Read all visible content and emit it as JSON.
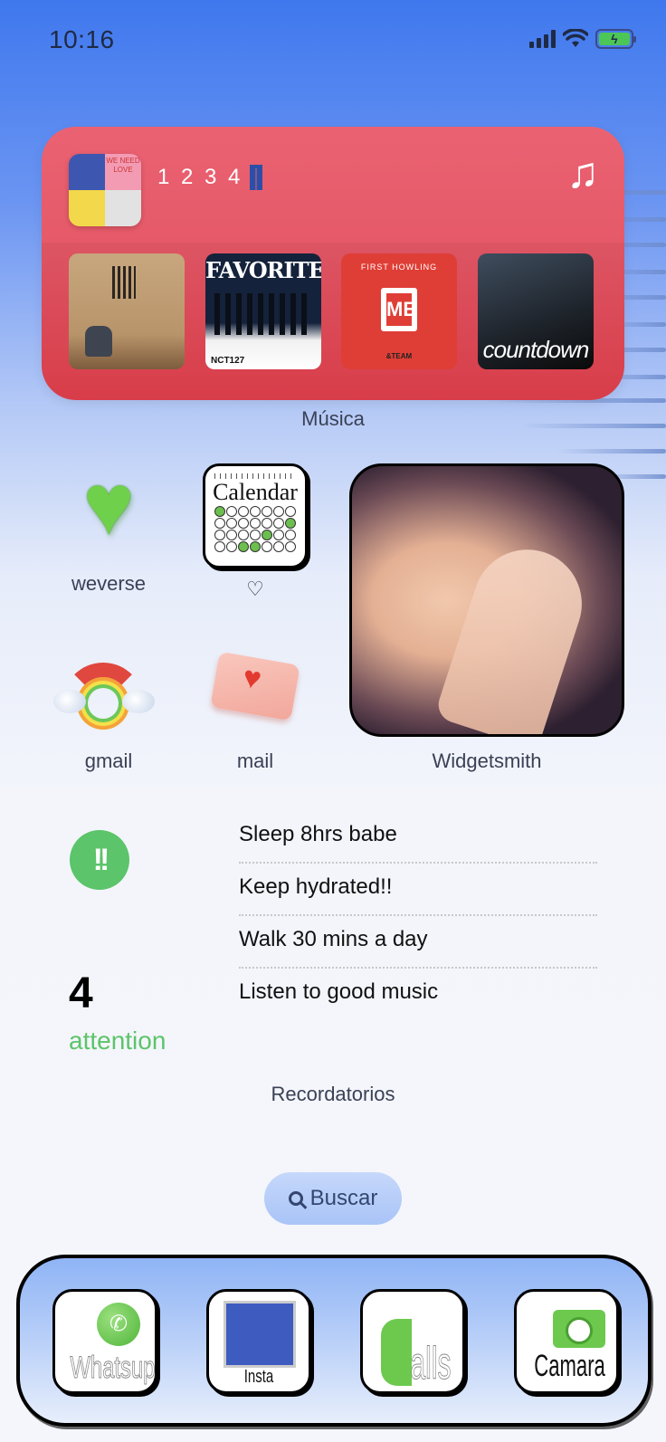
{
  "status_bar": {
    "time": "10:16",
    "signal_icon": "cellular-signal-icon",
    "wifi_icon": "wifi-icon",
    "battery_icon": "battery-charging-icon",
    "battery_charging_glyph": "ϟ"
  },
  "music_widget": {
    "playlist_title": "1 2 3 4",
    "playlist_emoji": "jeans-icon",
    "note_glyph": "♫",
    "playlist_art_text": "WE NEED LOVE",
    "albums": [
      {
        "title": "",
        "subtitle": ""
      },
      {
        "title": "FAVORITE",
        "subtitle": "NCT127"
      },
      {
        "title": "FIRST HOWLING",
        "logo": "ME",
        "subtitle": "&TEAM"
      },
      {
        "title": "countdown",
        "subtitle": ""
      }
    ],
    "label": "Música"
  },
  "apps": [
    {
      "label": "weverse",
      "icon": "green-heart-icon",
      "glyph": "♥"
    },
    {
      "label": "♡",
      "icon": "calendar-icon",
      "icon_text": "Calendar"
    },
    {
      "label": "gmail",
      "icon": "rainbow-icon"
    },
    {
      "label": "mail",
      "icon": "love-letter-icon",
      "glyph": "♥"
    }
  ],
  "photo_widget": {
    "label": "Widgetsmith"
  },
  "reminders": {
    "icon_glyph": "!!",
    "count": "4",
    "status": "attention",
    "items": [
      "Sleep 8hrs babe",
      "Keep hydrated!!",
      "Walk 30 mins a day",
      "Listen to good music"
    ],
    "label": "Recordatorios"
  },
  "search": {
    "label": "Buscar"
  },
  "dock": [
    {
      "label": "Whatsup",
      "glyph": "✆"
    },
    {
      "label": "Insta"
    },
    {
      "label": "alls"
    },
    {
      "label": "Camara"
    }
  ],
  "colors": {
    "music_red": "#e65a69",
    "accent_green": "#5cc46a",
    "sky_blue": "#3f78ee"
  }
}
